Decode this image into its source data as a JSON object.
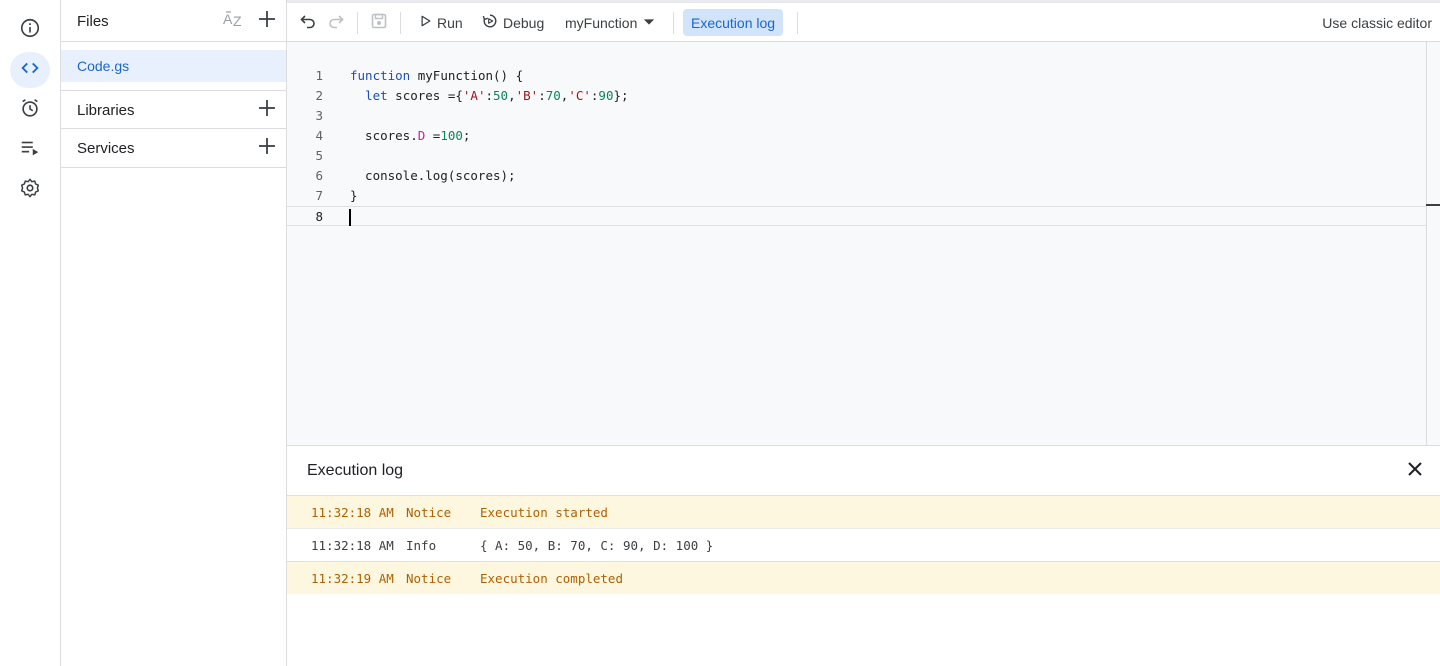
{
  "files_panel": {
    "title": "Files",
    "sort_icon": "sort-az-icon",
    "files": [
      {
        "name": "Code.gs"
      }
    ],
    "sections": [
      {
        "label": "Libraries"
      },
      {
        "label": "Services"
      }
    ]
  },
  "rail": {
    "items": [
      {
        "icon": "info-icon"
      },
      {
        "icon": "code-icon"
      },
      {
        "icon": "alarm-icon"
      },
      {
        "icon": "executions-icon"
      },
      {
        "icon": "gear-icon"
      }
    ]
  },
  "toolbar": {
    "run_label": "Run",
    "debug_label": "Debug",
    "function_name": "myFunction",
    "execution_log_label": "Execution log",
    "classic_editor_label": "Use classic editor"
  },
  "editor": {
    "line_numbers": [
      "1",
      "2",
      "3",
      "4",
      "5",
      "6",
      "7",
      "8"
    ],
    "lines": [
      "function myFunction() {",
      "  let scores ={'A':50,'B':70,'C':90};",
      "",
      "  scores.D =100;",
      "",
      "  console.log(scores);",
      "}",
      ""
    ],
    "current_line": 8
  },
  "execution_log": {
    "title": "Execution log",
    "rows": [
      {
        "time": "11:32:18 AM",
        "level": "Notice",
        "message": "Execution started"
      },
      {
        "time": "11:32:18 AM",
        "level": "Info",
        "message": "{ A: 50, B: 70, C: 90, D: 100 }"
      },
      {
        "time": "11:32:19 AM",
        "level": "Notice",
        "message": "Execution completed"
      }
    ]
  },
  "colors": {
    "accent": "#1967d2",
    "active_bg": "#e8f0fe",
    "notice_bg": "#fef7e0",
    "notice_text": "#b06000"
  }
}
